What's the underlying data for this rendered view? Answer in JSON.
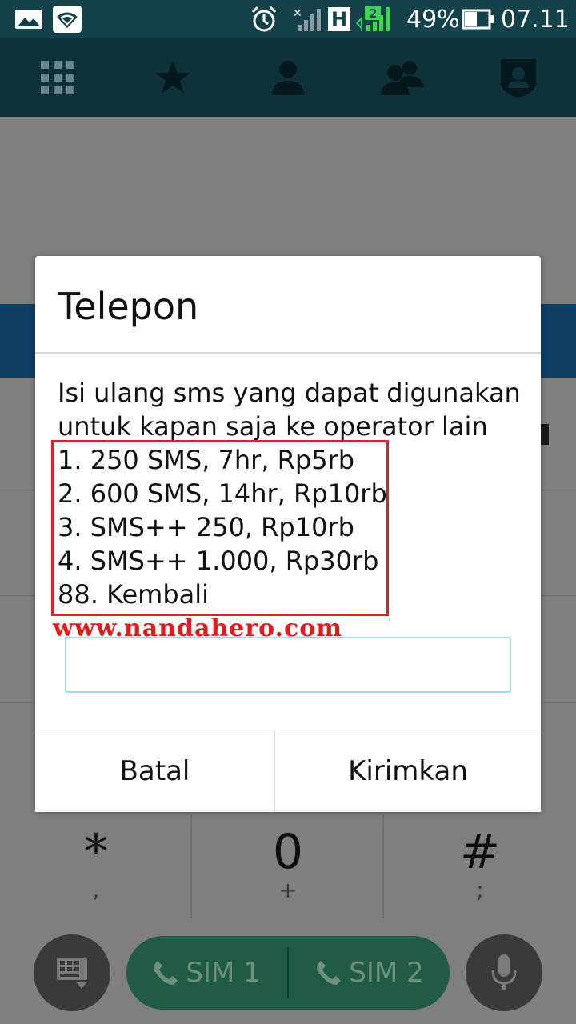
{
  "status_bar": {
    "battery_percent": "49%",
    "time": "07.11",
    "network_type": "H",
    "sim_slot_badge": "2",
    "icons": [
      "gallery-icon",
      "wifi-icon",
      "alarm-icon",
      "no-signal-icon",
      "h-network-icon",
      "signal-sim2-icon",
      "battery-icon"
    ]
  },
  "tabs": [
    {
      "name": "dialpad",
      "icon": "dialpad-grid-icon"
    },
    {
      "name": "favorites",
      "icon": "star-icon"
    },
    {
      "name": "contacts",
      "icon": "person-icon"
    },
    {
      "name": "groups",
      "icon": "group-icon"
    },
    {
      "name": "profile",
      "icon": "badge-person-icon"
    }
  ],
  "dialog": {
    "title": "Telepon",
    "message_lines": [
      "Isi ulang sms yang dapat digunakan",
      "untuk kapan saja ke operator lain",
      "1. 250 SMS, 7hr, Rp5rb",
      "2. 600 SMS, 14hr, Rp10rb",
      "3. SMS++ 250, Rp10rb",
      "4. SMS++ 1.000, Rp30rb",
      "88. Kembali"
    ],
    "watermark": "www.nandahero.com",
    "input_value": "",
    "cancel_label": "Batal",
    "send_label": "Kirimkan"
  },
  "keypad": [
    {
      "main": "*",
      "sub": ","
    },
    {
      "main": "0",
      "sub": "+"
    },
    {
      "main": "#",
      "sub": ";"
    }
  ],
  "call_bar": {
    "sim1_label": "SIM 1",
    "sim2_label": "SIM 2"
  },
  "colors": {
    "status_bar": "#13424c",
    "highlight_border": "#d3232e",
    "watermark": "#e11b1b",
    "sim_pill": "#1f5c43"
  }
}
